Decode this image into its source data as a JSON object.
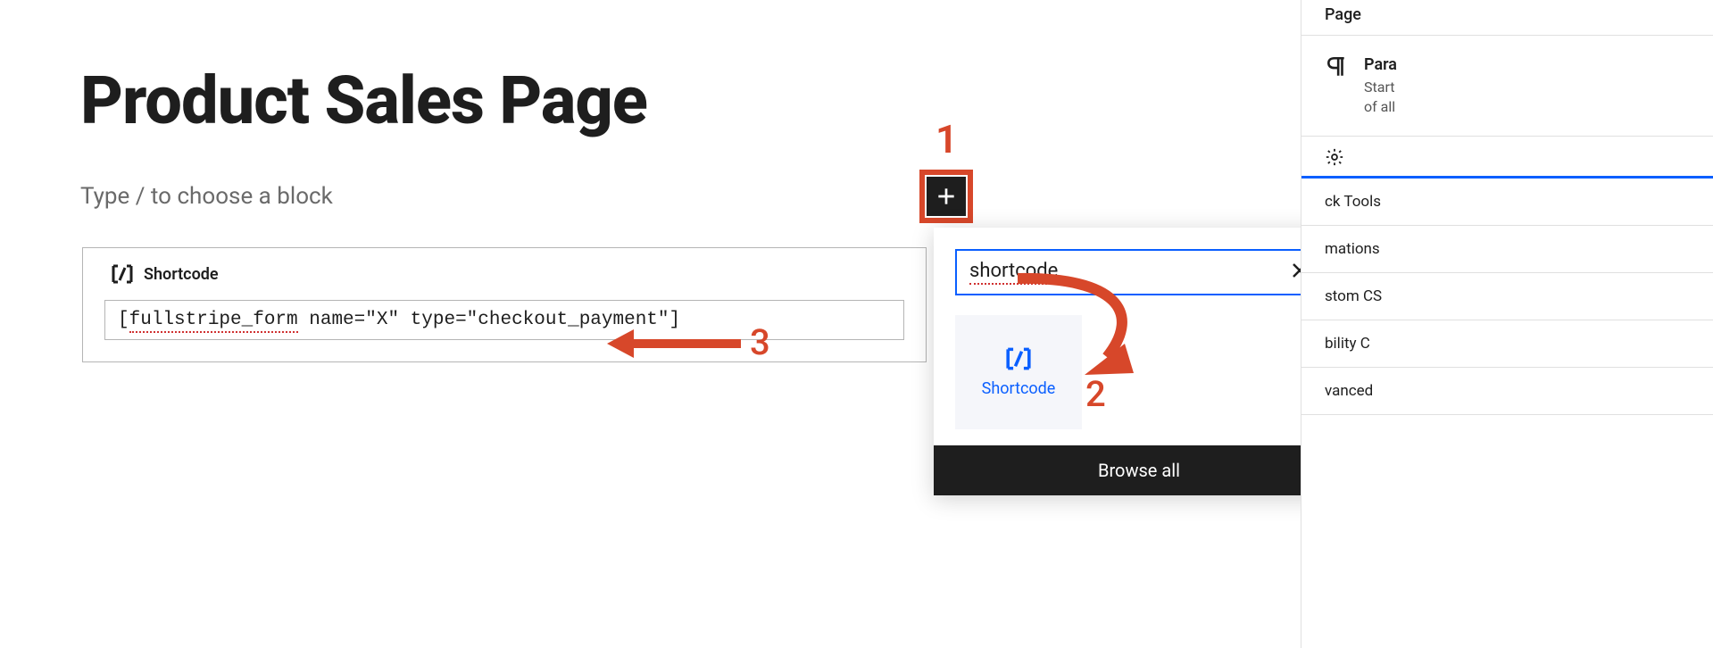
{
  "annotations": {
    "one": "1",
    "two": "2",
    "three": "3"
  },
  "editor": {
    "page_title": "Product Sales Page",
    "placeholder": "Type / to choose a block"
  },
  "shortcode_block": {
    "header_label": "Shortcode",
    "code_parts": {
      "bracket_open": "[",
      "underlined": "fullstripe_form",
      "rest": " name=\"X\" type=\"checkout_payment\"]"
    }
  },
  "inserter": {
    "search_value": "shortcode",
    "result_label": "Shortcode",
    "browse_all": "Browse all"
  },
  "sidebar": {
    "tabs": {
      "page": "Page"
    },
    "block": {
      "name_prefix": "Para",
      "desc_line1": "Start",
      "desc_line2": "of all"
    },
    "sections": {
      "tools": "ck Tools",
      "mations": "mations",
      "custom_css": "stom CS",
      "bility": "bility C",
      "advanced": "vanced"
    }
  }
}
